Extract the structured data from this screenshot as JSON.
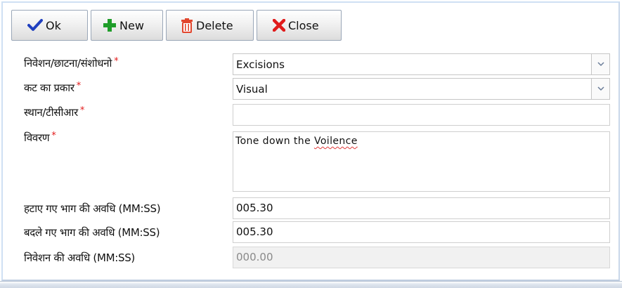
{
  "toolbar": {
    "ok_label": "Ok",
    "new_label": "New",
    "delete_label": "Delete",
    "close_label": "Close"
  },
  "form": {
    "required_mark": "*",
    "type": {
      "label": "निवेशन/छाटना/संशोधनो",
      "value": "Excisions"
    },
    "cut_type": {
      "label": "कट का प्रकार",
      "value": "Visual"
    },
    "location": {
      "label": "स्थान/टीसीआर",
      "value": ""
    },
    "description": {
      "label": "विवरण",
      "value_prefix": "Tone down the ",
      "value_misspelled": "Voilence"
    },
    "removed_duration": {
      "label": "हटाए गए भाग की अवधि (MM:SS)",
      "value": "005.30"
    },
    "replaced_duration": {
      "label": "बदले गए भाग की अवधि (MM:SS)",
      "value": "005.30"
    },
    "inserted_duration": {
      "label": "निवेशन की अवधि (MM:SS)",
      "value": "000.00"
    }
  },
  "colors": {
    "required": "#e31b1b",
    "ok_check": "#1f3fbf",
    "new_plus": "#1f9d2a",
    "delete_bin": "#e2462d",
    "close_x": "#e01b1b"
  },
  "icons": {
    "ok": "checkmark-icon",
    "new": "plus-icon",
    "delete": "trash-icon",
    "close": "x-icon",
    "dropdown": "chevron-down-icon"
  }
}
